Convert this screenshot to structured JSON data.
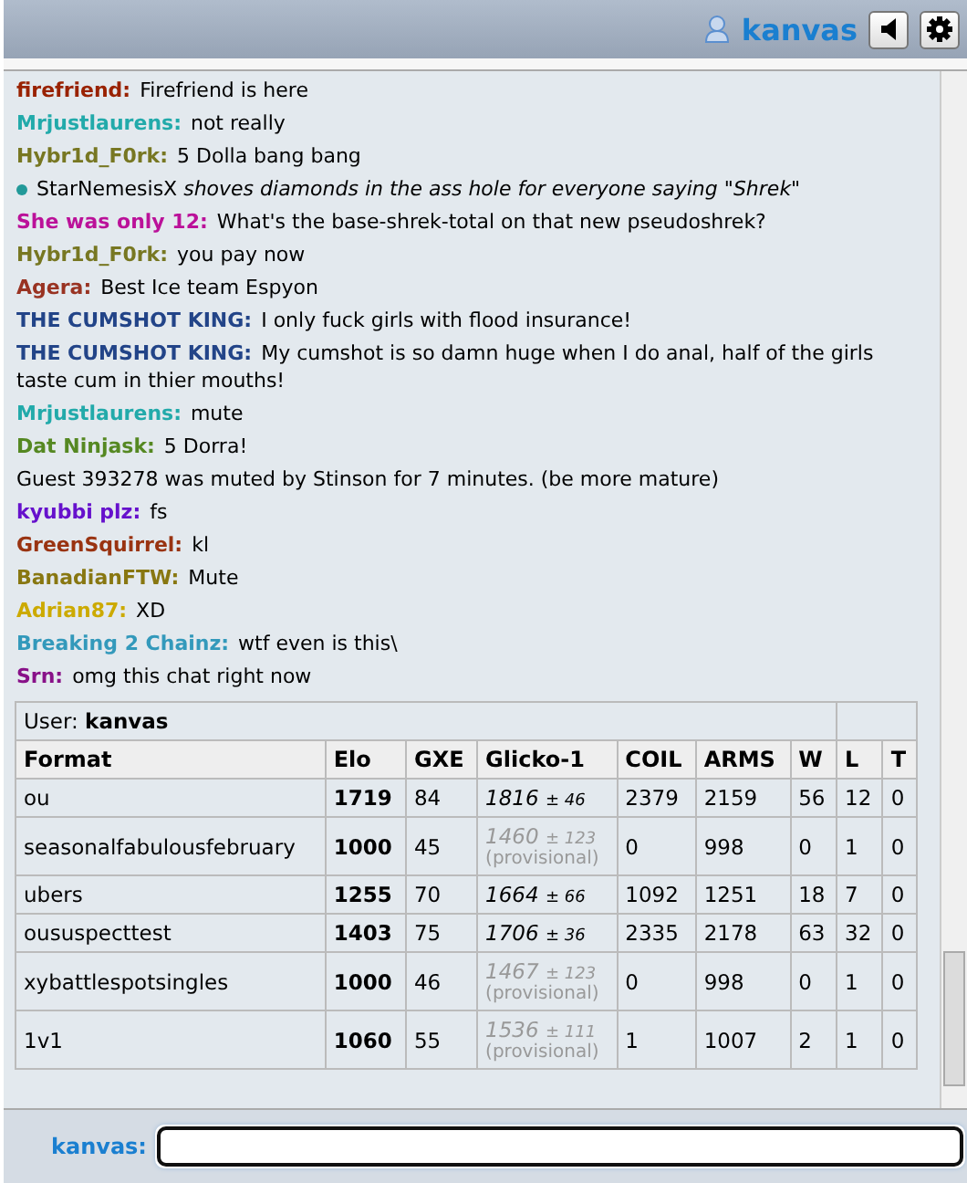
{
  "header": {
    "username": "kanvas"
  },
  "messages": [
    {
      "kind": "chat",
      "user": "firefriend:",
      "color": "#992200",
      "text": "Firefriend is here"
    },
    {
      "kind": "chat",
      "user": "Mrjustlaurens:",
      "color": "#22aaaa",
      "text": "not really"
    },
    {
      "kind": "chat",
      "user": "Hybr1d_F0rk:",
      "color": "#777722",
      "text": "5 Dolla bang bang"
    },
    {
      "kind": "emote",
      "user": "StarNemesisX",
      "color": "#229999",
      "text": "shoves diamonds in the ass hole for everyone saying \"Shrek\""
    },
    {
      "kind": "chat",
      "user": "She was only 12:",
      "color": "#bb1199",
      "text": "What's the base-shrek-total on that new pseudoshrek?"
    },
    {
      "kind": "chat",
      "user": "Hybr1d_F0rk:",
      "color": "#777722",
      "text": "you pay now"
    },
    {
      "kind": "chat",
      "user": "Agera:",
      "color": "#993322",
      "text": "Best Ice team Espyon"
    },
    {
      "kind": "chat",
      "user": "THE CUMSHOT KING:",
      "color": "#224488",
      "text": "I only fuck girls with flood insurance!"
    },
    {
      "kind": "chat",
      "user": "THE CUMSHOT KING:",
      "color": "#224488",
      "text": "My cumshot is so damn huge when I do anal, half of the girls taste cum in thier mouths!"
    },
    {
      "kind": "chat",
      "user": "Mrjustlaurens:",
      "color": "#22aaaa",
      "text": "mute"
    },
    {
      "kind": "chat",
      "user": "Dat Ninjask:",
      "color": "#558822",
      "text": "5 Dorra!"
    },
    {
      "kind": "system",
      "text": "Guest 393278 was muted by Stinson for 7 minutes. (be more mature)"
    },
    {
      "kind": "chat",
      "user": "kyubbi plz:",
      "color": "#6611cc",
      "text": "fs"
    },
    {
      "kind": "chat",
      "user": "GreenSquirrel:",
      "color": "#993311",
      "text": "kl"
    },
    {
      "kind": "chat",
      "user": "BanadianFTW:",
      "color": "#887711",
      "text": "Mute"
    },
    {
      "kind": "chat",
      "user": "Adrian87:",
      "color": "#ccaa00",
      "text": "XD"
    },
    {
      "kind": "chat",
      "user": "Breaking 2 Chainz:",
      "color": "#3399bb",
      "text": "wtf even is this\\"
    },
    {
      "kind": "chat",
      "user": "Srn:",
      "color": "#881188",
      "text": "omg this chat right now"
    }
  ],
  "ladder": {
    "user_label": "User:",
    "user": "kanvas",
    "columns": [
      "Format",
      "Elo",
      "GXE",
      "Glicko-1",
      "COIL",
      "ARMS",
      "W",
      "L",
      "T"
    ],
    "rows": [
      {
        "format": "ou",
        "elo": "1719",
        "gxe": "84",
        "glicko": "1816",
        "deviation": "± 46",
        "provisional": false,
        "coil": "2379",
        "arms": "2159",
        "w": "56",
        "l": "12",
        "t": "0"
      },
      {
        "format": "seasonalfabulousfebruary",
        "elo": "1000",
        "gxe": "45",
        "glicko": "1460",
        "deviation": "± 123",
        "provisional": true,
        "note": "(provisional)",
        "coil": "0",
        "arms": "998",
        "w": "0",
        "l": "1",
        "t": "0"
      },
      {
        "format": "ubers",
        "elo": "1255",
        "gxe": "70",
        "glicko": "1664",
        "deviation": "± 66",
        "provisional": false,
        "coil": "1092",
        "arms": "1251",
        "w": "18",
        "l": "7",
        "t": "0"
      },
      {
        "format": "oususpecttest",
        "elo": "1403",
        "gxe": "75",
        "glicko": "1706",
        "deviation": "± 36",
        "provisional": false,
        "coil": "2335",
        "arms": "2178",
        "w": "63",
        "l": "32",
        "t": "0"
      },
      {
        "format": "xybattlespotsingles",
        "elo": "1000",
        "gxe": "46",
        "glicko": "1467",
        "deviation": "± 123",
        "provisional": true,
        "note": "(provisional)",
        "coil": "0",
        "arms": "998",
        "w": "0",
        "l": "1",
        "t": "0"
      },
      {
        "format": "1v1",
        "elo": "1060",
        "gxe": "55",
        "glicko": "1536",
        "deviation": "± 111",
        "provisional": true,
        "note": "(provisional)",
        "coil": "1",
        "arms": "1007",
        "w": "2",
        "l": "1",
        "t": "0"
      }
    ]
  },
  "composer": {
    "label": "kanvas:"
  }
}
